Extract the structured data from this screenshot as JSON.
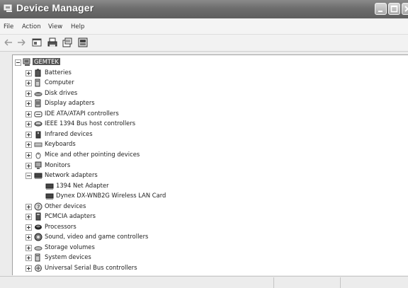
{
  "window": {
    "title": "Device Manager"
  },
  "menu": [
    "File",
    "Action",
    "View",
    "Help"
  ],
  "toolbar": {
    "back": "back-arrow-icon",
    "forward": "forward-arrow-icon",
    "buttons": [
      "show-hide-console-tree-icon",
      "print-icon",
      "properties-icon",
      "help-icon"
    ]
  },
  "tree": {
    "root": "GEMTEK",
    "categories": [
      {
        "label": "Batteries",
        "icon": "battery-icon",
        "expanded": false
      },
      {
        "label": "Computer",
        "icon": "computer-icon",
        "expanded": false
      },
      {
        "label": "Disk drives",
        "icon": "disk-drive-icon",
        "expanded": false
      },
      {
        "label": "Display adapters",
        "icon": "display-adapter-icon",
        "expanded": false
      },
      {
        "label": "IDE ATA/ATAPI controllers",
        "icon": "ide-controller-icon",
        "expanded": false
      },
      {
        "label": "IEEE 1394 Bus host controllers",
        "icon": "ieee1394-icon",
        "expanded": false
      },
      {
        "label": "Infrared devices",
        "icon": "infrared-icon",
        "expanded": false
      },
      {
        "label": "Keyboards",
        "icon": "keyboard-icon",
        "expanded": false
      },
      {
        "label": "Mice and other pointing devices",
        "icon": "mouse-icon",
        "expanded": false
      },
      {
        "label": "Monitors",
        "icon": "monitor-icon",
        "expanded": false
      },
      {
        "label": "Network adapters",
        "icon": "network-adapter-icon",
        "expanded": true,
        "children": [
          "1394 Net Adapter",
          "Dynex DX-WNB2G Wireless LAN Card"
        ]
      },
      {
        "label": "Other devices",
        "icon": "other-devices-icon",
        "expanded": false
      },
      {
        "label": "PCMCIA adapters",
        "icon": "pcmcia-icon",
        "expanded": false
      },
      {
        "label": "Processors",
        "icon": "processor-icon",
        "expanded": false
      },
      {
        "label": "Sound, video and game controllers",
        "icon": "sound-icon",
        "expanded": false
      },
      {
        "label": "Storage volumes",
        "icon": "storage-volume-icon",
        "expanded": false
      },
      {
        "label": "System devices",
        "icon": "system-devices-icon",
        "expanded": false
      },
      {
        "label": "Universal Serial Bus controllers",
        "icon": "usb-icon",
        "expanded": false
      }
    ]
  },
  "colors": {
    "titlebar": "#6d6d6d",
    "selection": "#555555",
    "pane": "#ffffff"
  }
}
